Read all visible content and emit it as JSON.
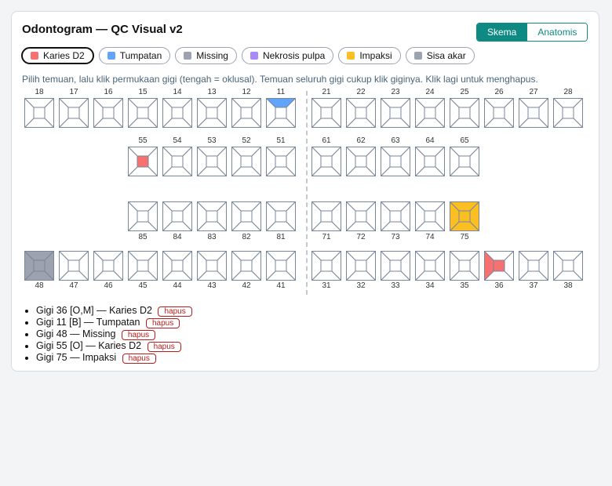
{
  "app": {
    "title": "Odontogram — QC Visual v2",
    "view_modes": [
      {
        "label": "Skema",
        "active": true
      },
      {
        "label": "Anatomis",
        "active": false
      }
    ]
  },
  "findings_types": [
    {
      "label": "Karies D2",
      "color": "#f87171",
      "active": true
    },
    {
      "label": "Tumpatan",
      "color": "#60a5fa",
      "active": false
    },
    {
      "label": "Missing",
      "color": "#9ca3af",
      "active": false
    },
    {
      "label": "Nekrosis pulpa",
      "color": "#a78bfa",
      "active": false
    },
    {
      "label": "Impaksi",
      "color": "#fbbf24",
      "active": false
    },
    {
      "label": "Sisa akar",
      "color": "#9ca3af",
      "active": false
    }
  ],
  "hint": "Pilih temuan, lalu klik permukaan gigi (tengah = oklusal). Temuan seluruh gigi cukup klik giginya. Klik lagi untuk menghapus.",
  "rows": {
    "upper_permanent": [
      "18",
      "17",
      "16",
      "15",
      "14",
      "13",
      "12",
      "11",
      "21",
      "22",
      "23",
      "24",
      "25",
      "26",
      "27",
      "28"
    ],
    "upper_primary": [
      "55",
      "54",
      "53",
      "52",
      "51",
      "61",
      "62",
      "63",
      "64",
      "65"
    ],
    "lower_primary": [
      "85",
      "84",
      "83",
      "82",
      "81",
      "71",
      "72",
      "73",
      "74",
      "75"
    ],
    "lower_permanent": [
      "48",
      "47",
      "46",
      "45",
      "44",
      "43",
      "42",
      "41",
      "31",
      "32",
      "33",
      "34",
      "35",
      "36",
      "37",
      "38"
    ]
  },
  "tooth_marks": {
    "11": {
      "B": "#60a5fa"
    },
    "55": {
      "O": "#f87171"
    },
    "75": {
      "whole": "#fbbf24"
    },
    "48": {
      "whole": "#9ca3af"
    },
    "36": {
      "O": "#f87171",
      "M": "#f87171"
    }
  },
  "findings_list": [
    {
      "text": "Gigi 36 [O,M] — Karies D2",
      "delete_label": "hapus"
    },
    {
      "text": "Gigi 11 [B] — Tumpatan",
      "delete_label": "hapus"
    },
    {
      "text": "Gigi 48 — Missing",
      "delete_label": "hapus"
    },
    {
      "text": "Gigi 55 [O] — Karies D2",
      "delete_label": "hapus"
    },
    {
      "text": "Gigi 75 — Impaksi",
      "delete_label": "hapus"
    }
  ]
}
